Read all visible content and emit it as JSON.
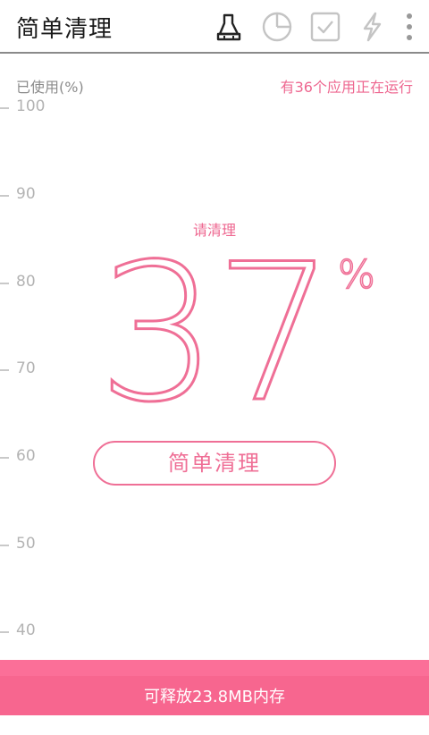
{
  "header": {
    "title": "简单清理",
    "icons": [
      "broom-icon",
      "pie-chart-icon",
      "checkbox-icon",
      "lightning-icon",
      "more-vertical-icon"
    ]
  },
  "gauge": {
    "axis_label": "已使用(%)",
    "scale_labels": [
      "100",
      "90",
      "80",
      "70",
      "60",
      "50",
      "40"
    ],
    "status_text": "请清理",
    "percent_value": "37",
    "percent_sign": "%"
  },
  "running_apps_text": "有36个应用正在运行",
  "clean_button_label": "简单清理",
  "footer_text": "可释放23.8MB内存",
  "colors": {
    "accent": "#ef6f96",
    "footer_bg": "#f7668f",
    "scale_text": "#b3b3b3"
  }
}
